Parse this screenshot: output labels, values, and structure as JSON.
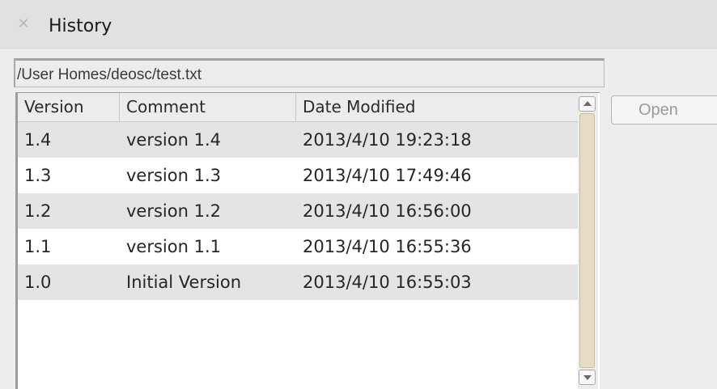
{
  "window": {
    "title": "History",
    "close_icon": "close-icon"
  },
  "path_field": {
    "value": "/User Homes/deosc/test.txt"
  },
  "table": {
    "columns": [
      "Version",
      "Comment",
      "Date Modified"
    ],
    "rows": [
      {
        "version": "1.4",
        "comment": "version 1.4",
        "date": "2013/4/10 19:23:18"
      },
      {
        "version": "1.3",
        "comment": "version 1.3",
        "date": "2013/4/10 17:49:46"
      },
      {
        "version": "1.2",
        "comment": "version 1.2",
        "date": "2013/4/10 16:56:00"
      },
      {
        "version": "1.1",
        "comment": "version 1.1",
        "date": "2013/4/10 16:55:36"
      },
      {
        "version": "1.0",
        "comment": "Initial Version",
        "date": "2013/4/10 16:55:03"
      }
    ]
  },
  "actions": {
    "open_label": "Open"
  },
  "icons": {
    "scroll_up": "scroll-up-arrow-icon",
    "scroll_down": "scroll-down-arrow-icon"
  },
  "colors": {
    "titlebar_bg": "#e1e1e1",
    "panel_bg": "#ededed",
    "row_shade": "#e4e4e4",
    "scroll_thumb": "#e6dcc6",
    "disabled_text": "#9a9a9a"
  }
}
